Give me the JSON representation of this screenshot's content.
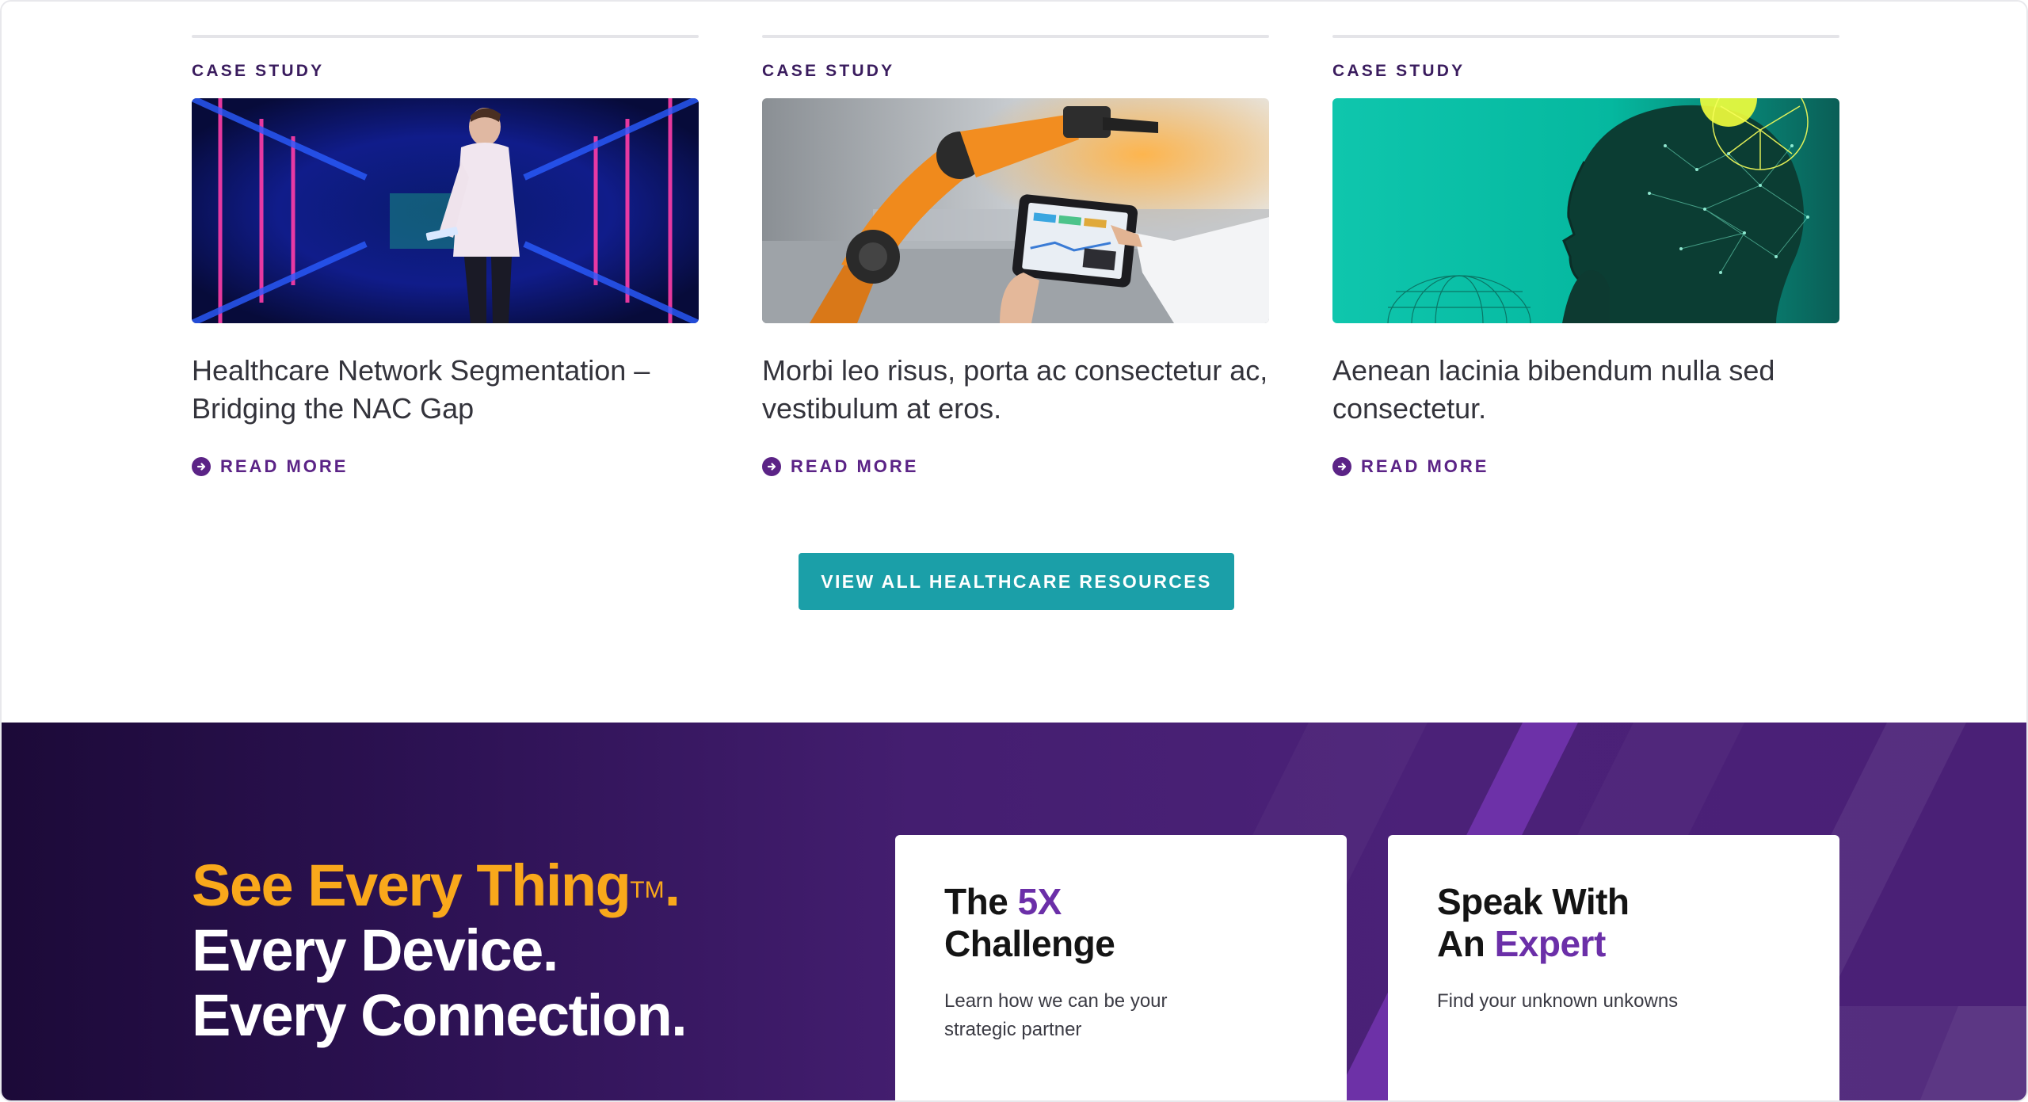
{
  "resources": {
    "cards": [
      {
        "eyebrow": "CASE STUDY",
        "headline": "Healthcare Network Segmentation – Bridging the NAC Gap",
        "read_more": "READ MORE",
        "image_alt": "Man holding tablet in neon blue data center corridor"
      },
      {
        "eyebrow": "CASE STUDY",
        "headline": "Morbi leo risus, porta ac consectetur ac, vestibulum at eros.",
        "read_more": "READ MORE",
        "image_alt": "Hand using tablet next to orange industrial robot arm"
      },
      {
        "eyebrow": "CASE STUDY",
        "headline": "Aenean lacinia bibendum nulla sed consectetur.",
        "read_more": "READ MORE",
        "image_alt": "Profile of woman with digital network overlay on teal background"
      }
    ],
    "view_all_label": "VIEW ALL HEALTHCARE RESOURCES"
  },
  "promo": {
    "tagline": {
      "line1": "See Every Thing",
      "trademark": "TM",
      "line1_end": ".",
      "line2": "Every Device.",
      "line3": "Every Connection."
    },
    "cards": [
      {
        "title_prefix": "The ",
        "title_accent": "5X",
        "title_suffix": "Challenge",
        "description": "Learn how we can be your strategic partner"
      },
      {
        "title_prefix": "Speak With",
        "title_accent": "Expert",
        "title_suffix_before": "An ",
        "description": "Find your unknown unkowns"
      }
    ]
  },
  "colors": {
    "eyebrow": "#3a1c5e",
    "link_purple": "#5b2386",
    "button_teal": "#1b9fa8",
    "tagline_gold": "#f9a81b",
    "promo_bg_dark": "#1c0a38",
    "promo_bg_light": "#4b2178",
    "accent_purple": "#6b2fa8"
  },
  "icons": {
    "read_more": "arrow-circle-right-icon"
  }
}
